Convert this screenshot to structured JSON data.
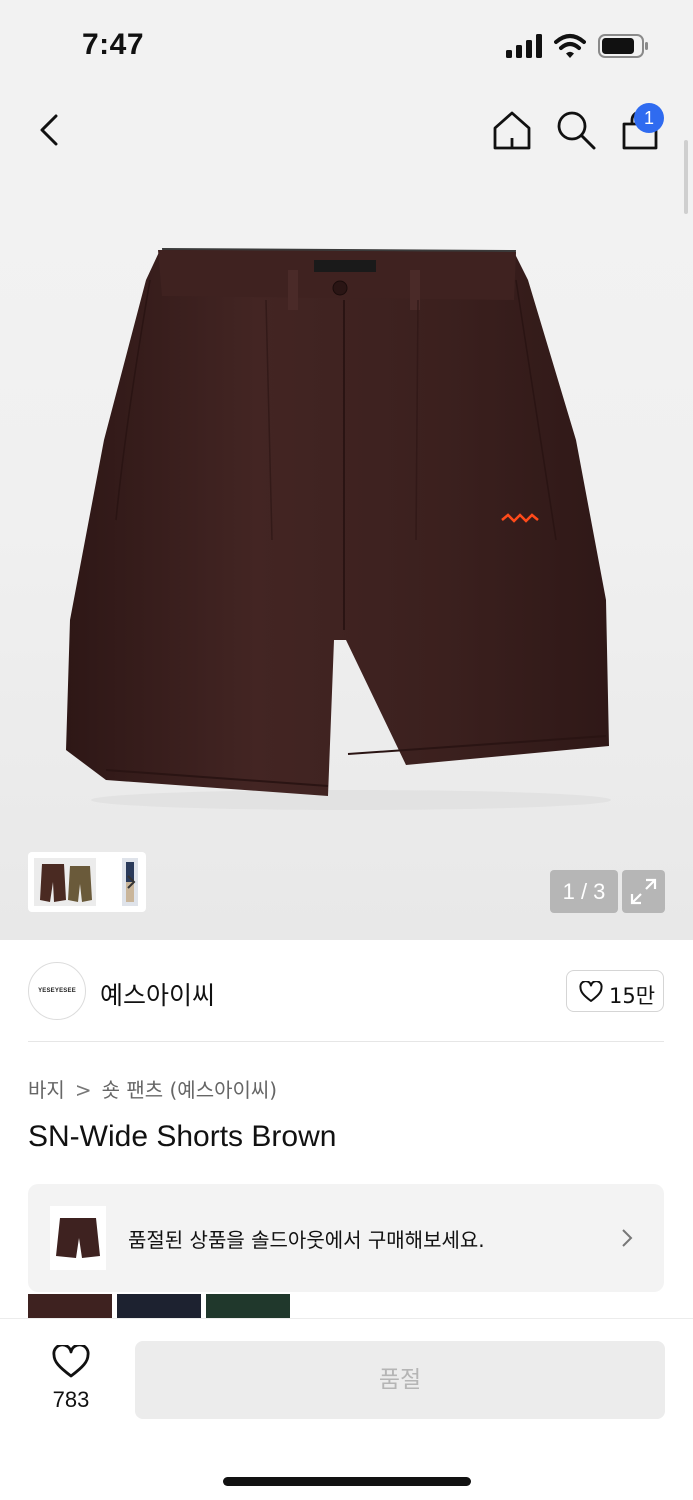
{
  "status_bar": {
    "time": "7:47"
  },
  "nav": {
    "cart_count": "1"
  },
  "gallery": {
    "counter": "1 / 3"
  },
  "brand": {
    "name": "예스아이씨",
    "logo_text": "YESEYESEE",
    "likes": "15만"
  },
  "breadcrumb": {
    "category": "바지",
    "separator": ">",
    "subcategory": "숏 팬츠 (예스아이씨)"
  },
  "product": {
    "title": "SN-Wide Shorts Brown",
    "color": "#3e2220"
  },
  "banner": {
    "text": "품절된 상품을 솔드아웃에서 구매해보세요."
  },
  "colors": [
    "#3e2220",
    "#1d2230",
    "#20382c"
  ],
  "bottom": {
    "wish_count": "783",
    "buy_label": "품절"
  },
  "accent": "#2f6bf0"
}
